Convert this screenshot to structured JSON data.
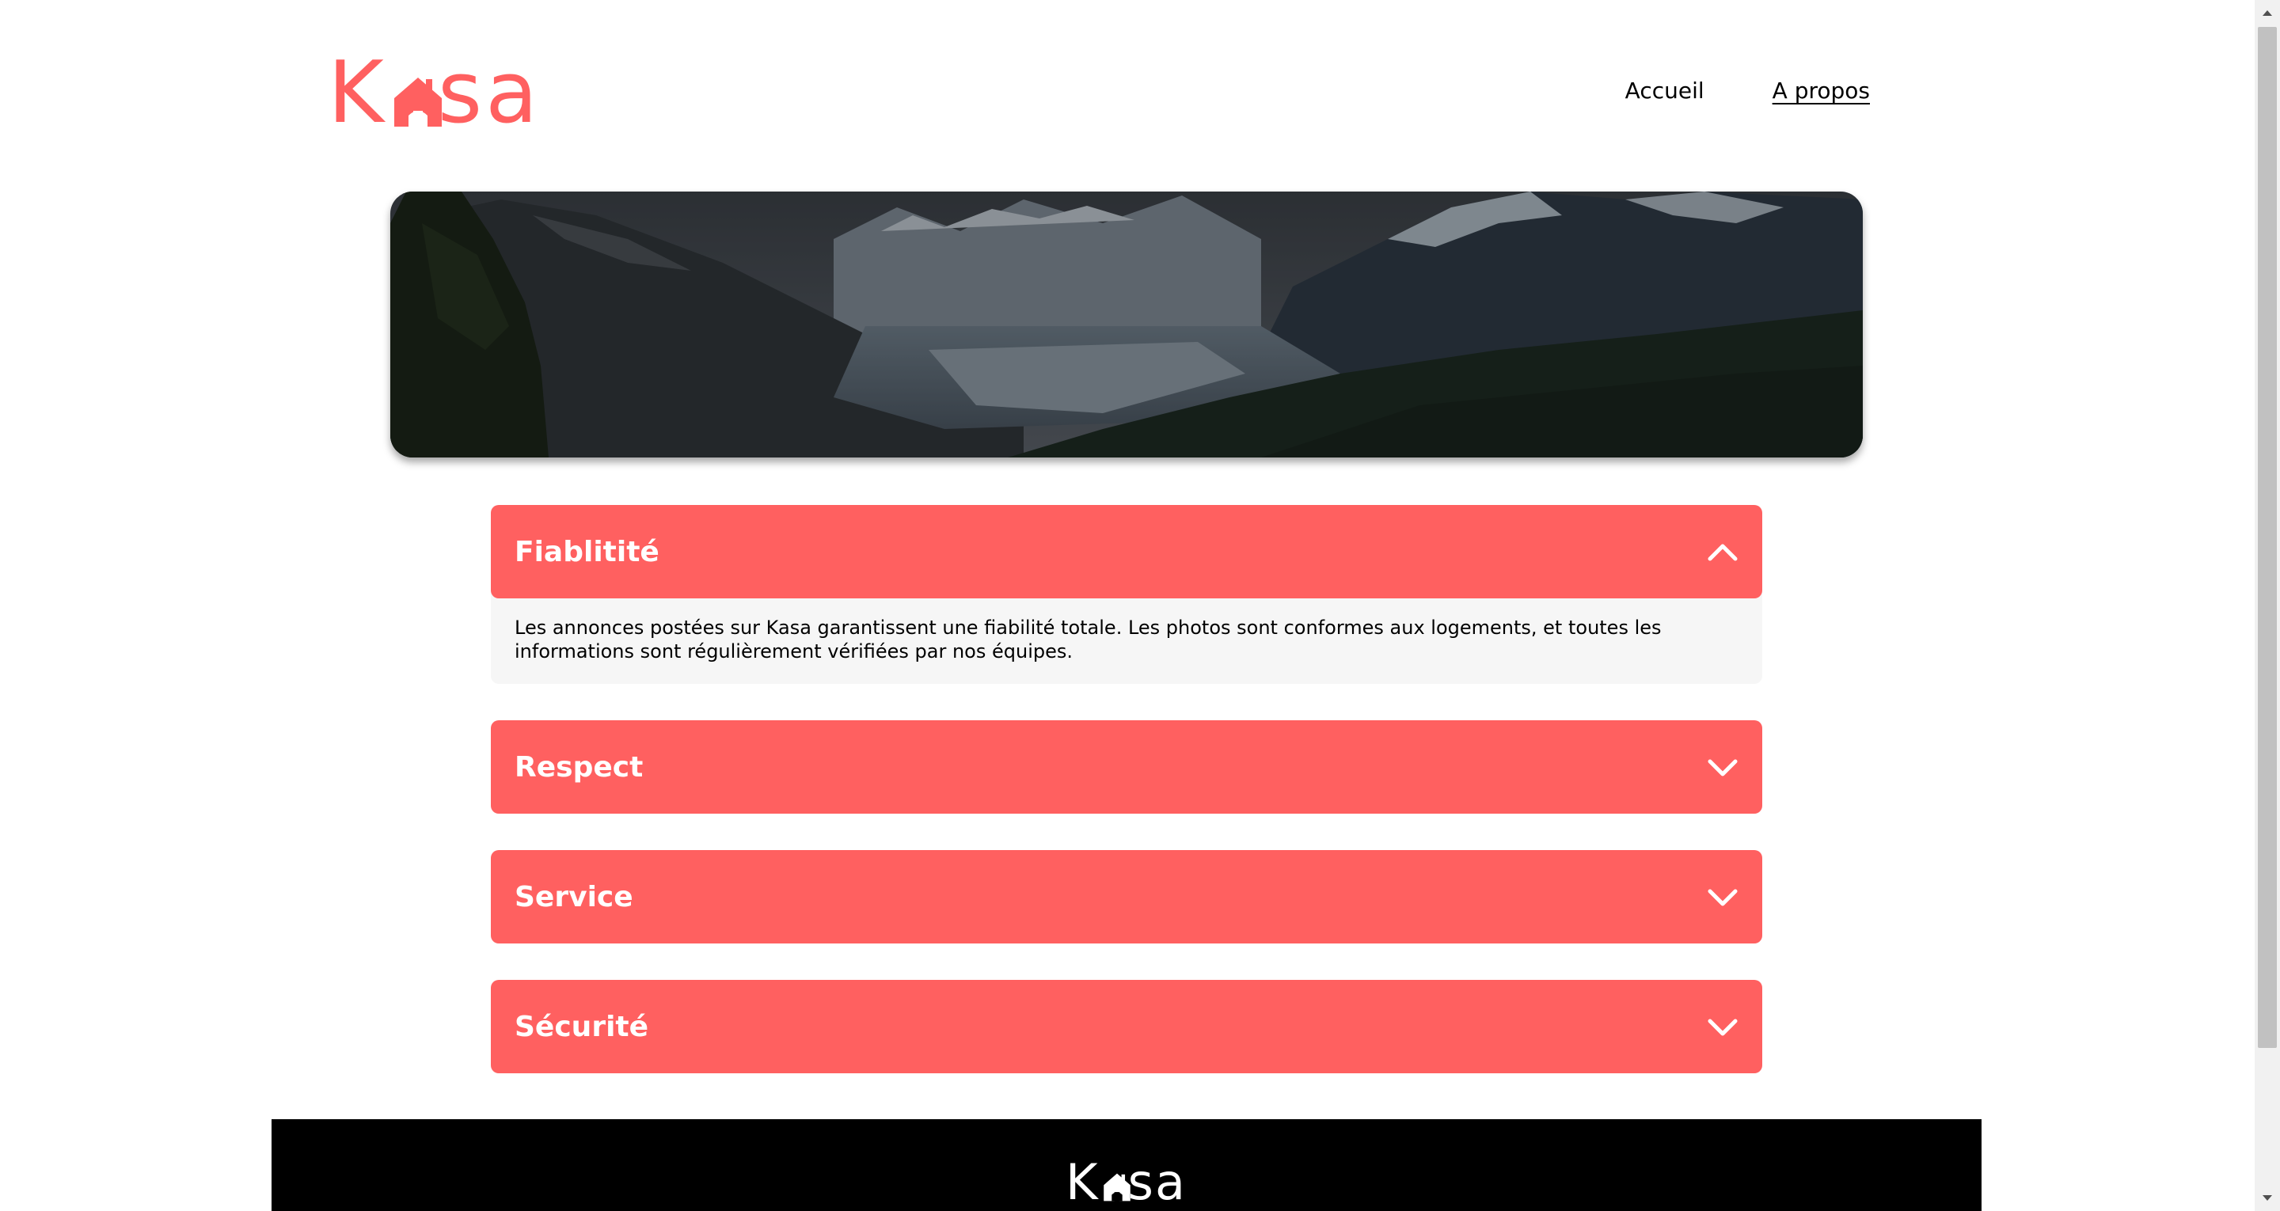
{
  "header": {
    "logo_text_start": "K",
    "logo_text_end": "sa",
    "nav": [
      {
        "label": "Accueil",
        "active": false
      },
      {
        "label": "A propos",
        "active": true
      }
    ]
  },
  "collapses": [
    {
      "title": "Fiablitité",
      "open": true,
      "content": "Les annonces postées sur Kasa garantissent une fiabilité totale. Les photos sont conformes aux logements, et toutes les informations sont régulièrement vérifiées par nos équipes."
    },
    {
      "title": "Respect",
      "open": false
    },
    {
      "title": "Service",
      "open": false
    },
    {
      "title": "Sécurité",
      "open": false
    }
  ],
  "footer": {
    "logo_text_start": "K",
    "logo_text_end": "sa"
  },
  "colors": {
    "brand": "#FF6060",
    "collapse_body_bg": "#F6F6F6",
    "footer_bg": "#000000"
  }
}
